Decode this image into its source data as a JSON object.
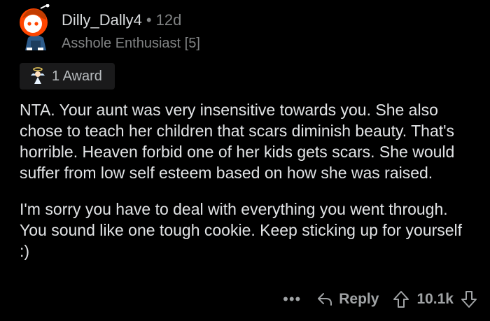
{
  "comment": {
    "author": "Dilly_Dally4",
    "separator": "•",
    "age": "12d",
    "flair": "Asshole Enthusiast [5]",
    "award": {
      "label": "1 Award",
      "icon": "angel-award-icon"
    },
    "paragraphs": [
      "NTA. Your aunt was very insensitive towards you. She also chose to teach her children that scars diminish beauty. That's horrible. Heaven forbid one of her kids gets scars. She would suffer from low self esteem based on how she was raised.",
      "I'm sorry you have to deal with everything you went through. You sound like one tough cookie. Keep sticking up for yourself :)"
    ],
    "actions": {
      "more": "•••",
      "reply": "Reply",
      "score": "10.1k"
    }
  },
  "colors": {
    "background": "#000000",
    "text": "#d7dadc",
    "muted": "#818384",
    "avatar_orange": "#ff4500"
  }
}
